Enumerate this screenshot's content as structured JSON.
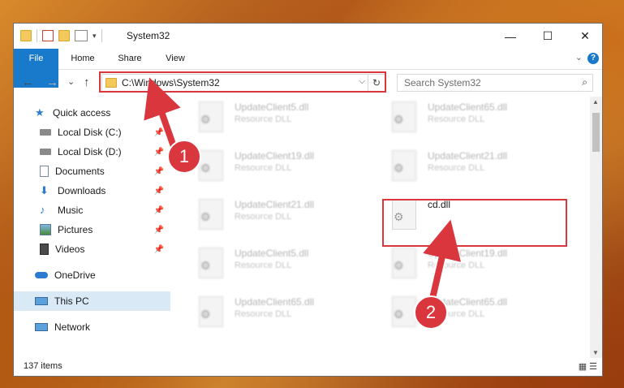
{
  "window": {
    "title": "System32",
    "controls": {
      "minimize": "—",
      "maximize": "☐",
      "close": "✕"
    }
  },
  "ribbon": {
    "tabs": [
      "File",
      "Home",
      "Share",
      "View"
    ],
    "help": "?"
  },
  "navbar": {
    "back": "←",
    "forward": "→",
    "recent": "⌄",
    "up": "↑",
    "address": "C:\\Windows\\System32",
    "dropdown": "⌵",
    "refresh": "↻",
    "search_placeholder": "Search System32",
    "search_icon": "⌕"
  },
  "sidebar": {
    "items": [
      {
        "label": "Quick access",
        "icon": "star-icon",
        "color": "#2b7bd1"
      },
      {
        "label": "Local Disk (C:)",
        "icon": "drive-icon",
        "pinned": true
      },
      {
        "label": "Local Disk (D:)",
        "icon": "drive-icon",
        "pinned": true
      },
      {
        "label": "Documents",
        "icon": "documents-icon",
        "pinned": true
      },
      {
        "label": "Downloads",
        "icon": "downloads-icon",
        "pinned": true
      },
      {
        "label": "Music",
        "icon": "music-icon",
        "pinned": true
      },
      {
        "label": "Pictures",
        "icon": "pictures-icon",
        "pinned": true
      },
      {
        "label": "Videos",
        "icon": "videos-icon",
        "pinned": true
      },
      {
        "label": "OneDrive",
        "icon": "onedrive-icon"
      },
      {
        "label": "This PC",
        "icon": "pc-icon",
        "selected": true
      },
      {
        "label": "Network",
        "icon": "network-icon"
      }
    ],
    "pin_glyph": "📌"
  },
  "files": [
    {
      "name": "UpdateClient5.dll",
      "type": "Resource DLL"
    },
    {
      "name": "UpdateClient65.dll",
      "type": "Resource DLL"
    },
    {
      "name": "UpdateClient19.dll",
      "type": "Resource DLL"
    },
    {
      "name": "UpdateClient21.dll",
      "type": "Resource DLL"
    },
    {
      "name": "UpdateClient21.dll",
      "type": "Resource DLL"
    },
    {
      "name": "cd.dll",
      "type": ""
    },
    {
      "name": "UpdateClient5.dll",
      "type": "Resource DLL"
    },
    {
      "name": "UpdateClient19.dll",
      "type": "Resource DLL"
    },
    {
      "name": "UpdateClient65.dll",
      "type": "Resource DLL"
    },
    {
      "name": "UpdateClient65.dll",
      "type": "Resource DLL"
    }
  ],
  "status": {
    "count": "137 items"
  },
  "callouts": [
    "1",
    "2"
  ],
  "colors": {
    "accent": "#1979ca",
    "highlight": "#d9363e",
    "selected": "#d9e9f6"
  }
}
